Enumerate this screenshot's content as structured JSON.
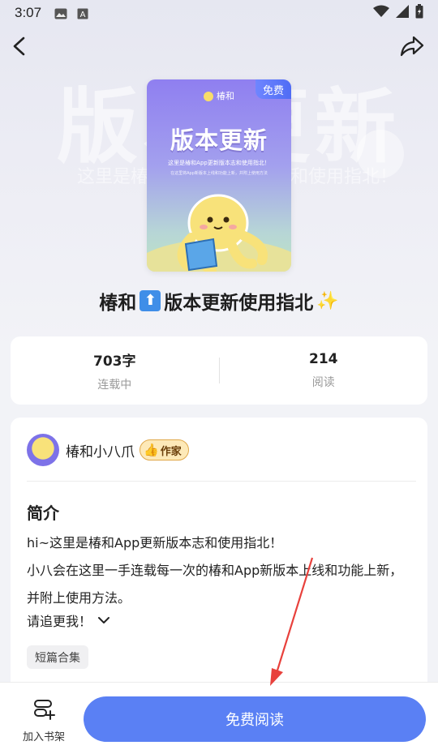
{
  "status_bar": {
    "time": "3:07",
    "icons": [
      "image-icon",
      "font-icon",
      "wifi-icon",
      "signal-icon",
      "battery-icon"
    ]
  },
  "nav": {
    "back_icon": "chevron-left-icon",
    "share_icon": "share-icon"
  },
  "cover": {
    "badge": "免费",
    "brand": "椿和",
    "title": "版本更新",
    "subtitle": "这里是椿和App更新版本志和使用指北！",
    "subtitle_small": "在这里将App新版本上线和功能上新，并附上使用方法"
  },
  "book": {
    "title_pre": "椿和",
    "title_icon": "⬆",
    "title_post": "版本更新使用指北",
    "title_emoji": "✨"
  },
  "stats": {
    "words": "703字",
    "status": "连载中",
    "reads": "214",
    "reads_label": "阅读"
  },
  "author": {
    "name": "椿和小八爪",
    "tag": "作家"
  },
  "intro": {
    "title": "简介",
    "line1": "hi~这里是椿和App更新版本志和使用指北！",
    "line2": "小八会在这里一手连载每一次的椿和App新版本上线和功能上新，并附上使用方法。",
    "more": "请追更我！",
    "tag": "短篇合集"
  },
  "bottom": {
    "shelf_label": "加入书架",
    "read_button": "免费阅读"
  },
  "colors": {
    "accent": "#5a80f4",
    "annotation_arrow": "#e8413c"
  }
}
